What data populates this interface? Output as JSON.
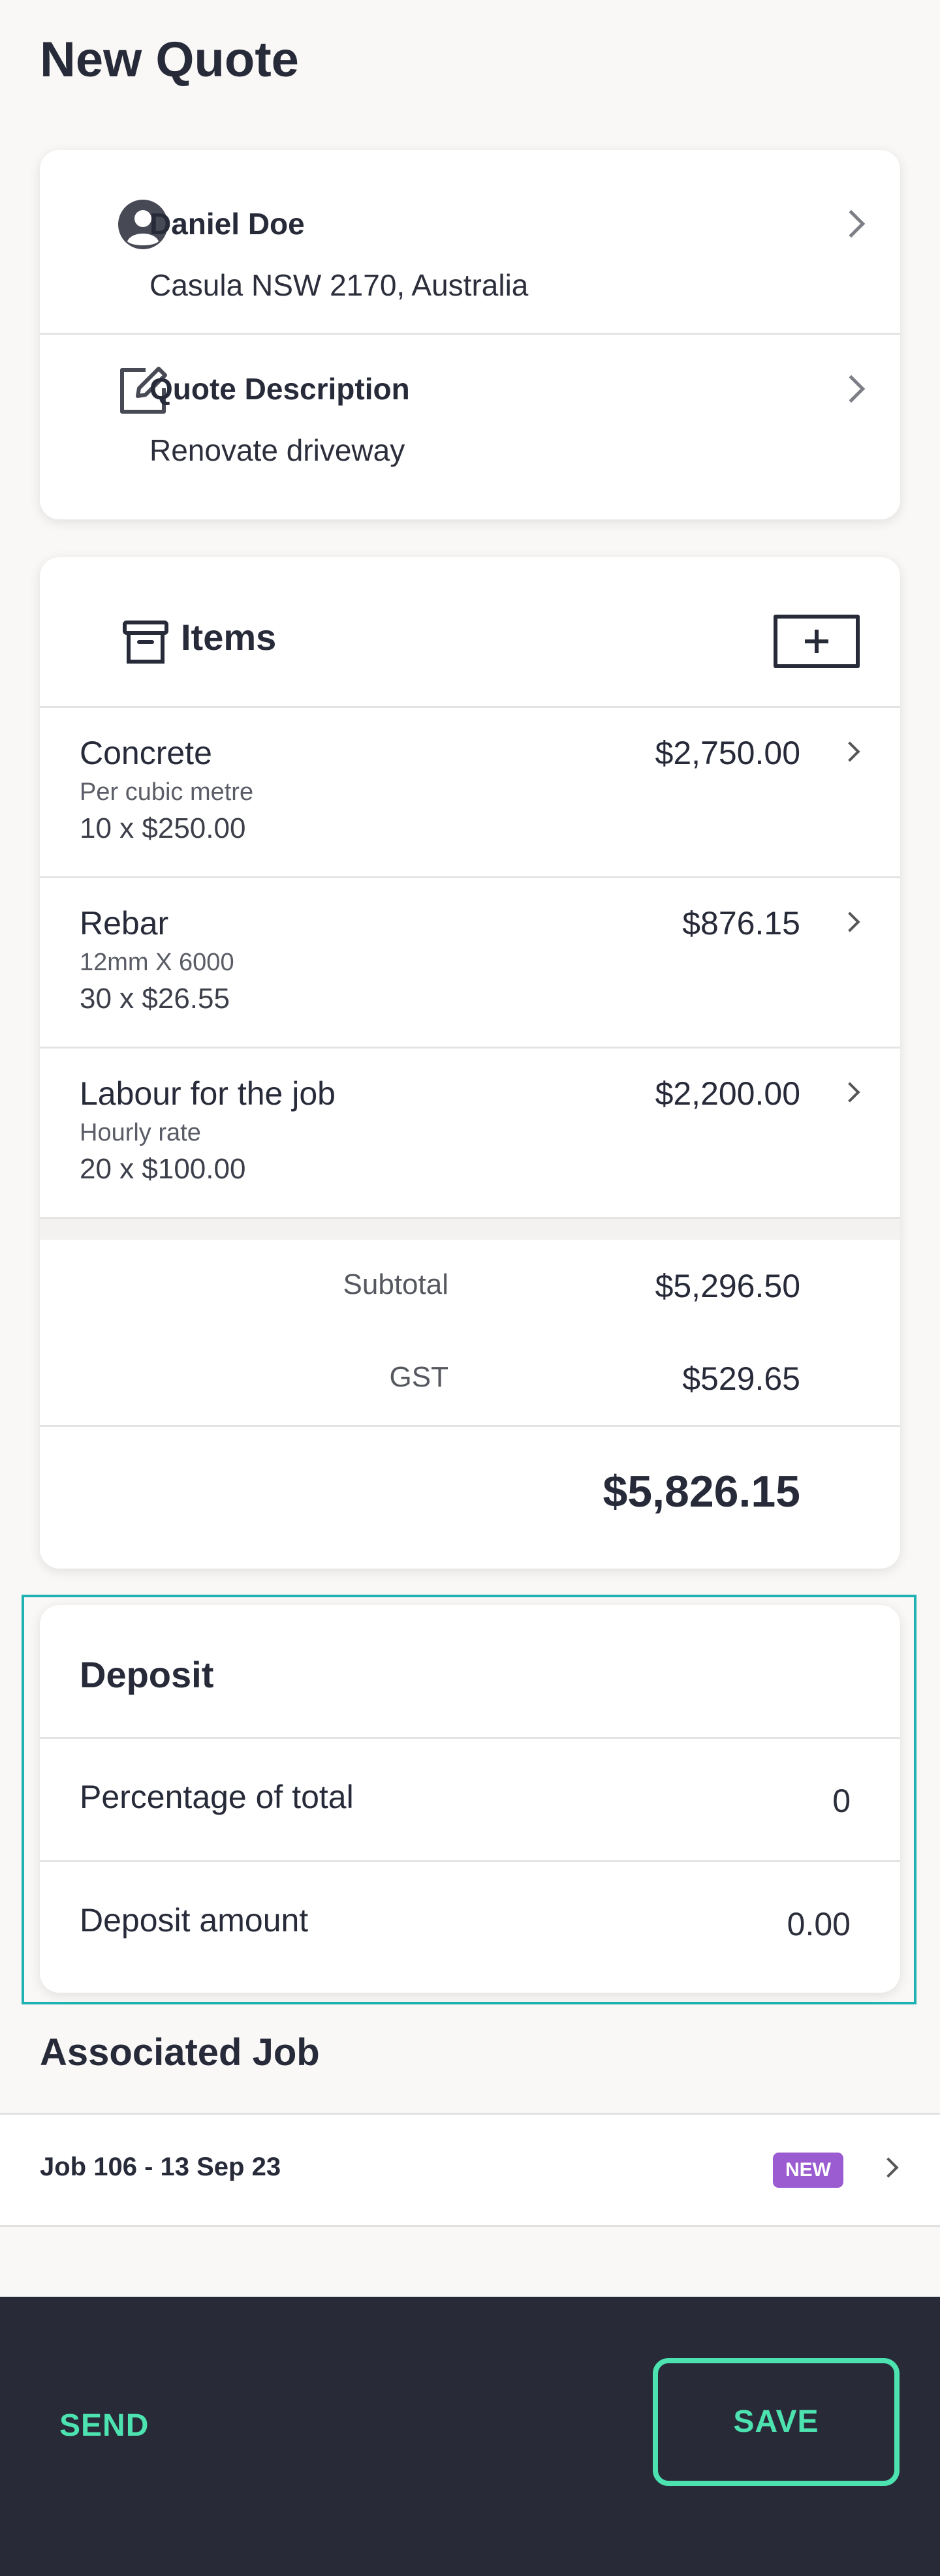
{
  "header": {
    "title": "New Quote"
  },
  "customer": {
    "name": "Daniel Doe",
    "address": "Casula NSW 2170, Australia"
  },
  "description": {
    "label": "Quote Description",
    "value": "Renovate driveway"
  },
  "items_section": {
    "title": "Items",
    "items": [
      {
        "name": "Concrete",
        "unit": "Per cubic metre",
        "qty_line": "10 x $250.00",
        "total": "$2,750.00"
      },
      {
        "name": "Rebar",
        "unit": "12mm X 6000",
        "qty_line": "30 x $26.55",
        "total": "$876.15"
      },
      {
        "name": "Labour for the job",
        "unit": "Hourly rate",
        "qty_line": "20 x $100.00",
        "total": "$2,200.00"
      }
    ],
    "subtotal_label": "Subtotal",
    "subtotal_value": "$5,296.50",
    "gst_label": "GST",
    "gst_value": "$529.65",
    "grand_total": "$5,826.15"
  },
  "deposit": {
    "title": "Deposit",
    "percentage_label": "Percentage of total",
    "percentage_value": "0",
    "amount_label": "Deposit amount",
    "amount_value": "0.00"
  },
  "associated_job": {
    "title": "Associated Job",
    "job_label": "Job 106 - 13 Sep 23",
    "status_badge": "NEW"
  },
  "footer": {
    "send_label": "SEND",
    "save_label": "SAVE"
  },
  "colors": {
    "accent": "#4de3b0",
    "dark": "#282a38",
    "badge": "#9a5cd0",
    "focus": "#20b2b2"
  }
}
